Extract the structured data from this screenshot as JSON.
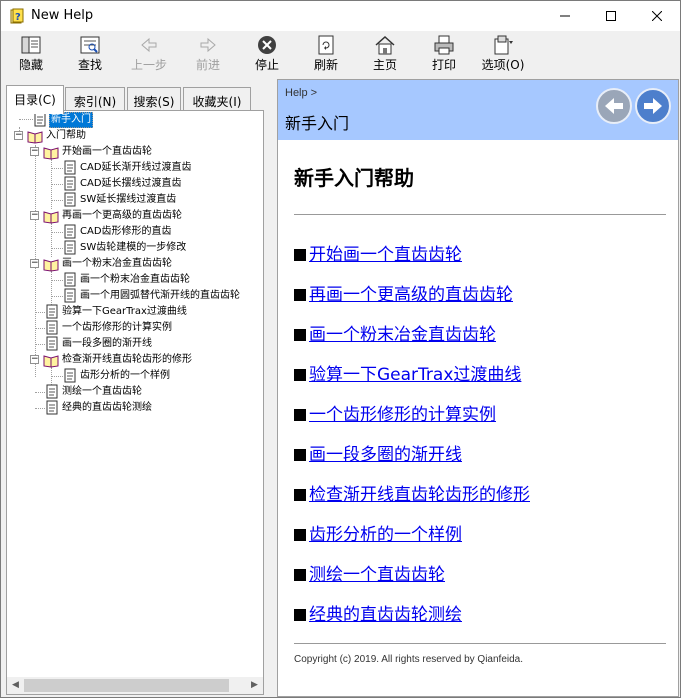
{
  "window": {
    "title": "New Help",
    "icon": "help-book-icon",
    "controls": [
      "minimize-icon",
      "maximize-icon",
      "close-icon"
    ]
  },
  "toolbar": {
    "hide": "隐藏",
    "find": "查找",
    "back": "上一步",
    "forward": "前进",
    "stop": "停止",
    "refresh": "刷新",
    "home": "主页",
    "print": "打印",
    "options": "选项(O)"
  },
  "tabs": {
    "contents": "目录(C)",
    "index": "索引(N)",
    "search": "搜索(S)",
    "favorites": "收藏夹(I)"
  },
  "tree": {
    "n0": "新手入门",
    "n1": "入门帮助",
    "n2": "开始画一个直齿齿轮",
    "n3": "CAD延长渐开线过渡直齿",
    "n4": "CAD延长摆线过渡直齿",
    "n5": "SW延长摆线过渡直齿",
    "n6": "再画一个更高级的直齿齿轮",
    "n7": "CAD齿形修形的直齿",
    "n8": "SW齿轮建模的一步修改",
    "n9": "画一个粉末冶金直齿齿轮",
    "n10": "画一个粉末冶金直齿齿轮",
    "n11": "画一个用圆弧替代渐开线的直齿齿轮",
    "n12": "验算一下GearTrax过渡曲线",
    "n13": "一个齿形修形的计算实例",
    "n14": "画一段多圈的渐开线",
    "n15": "检查渐开线直齿轮齿形的修形",
    "n16": "齿形分析的一个样例",
    "n17": "测绘一个直齿齿轮",
    "n18": "经典的直齿齿轮测绘"
  },
  "content": {
    "breadcrumb": "Help >",
    "header_title": "新手入门",
    "title": "新手入门帮助",
    "topics": [
      "开始画一个直齿齿轮",
      "再画一个更高级的直齿齿轮",
      "画一个粉末冶金直齿齿轮",
      "验算一下GearTrax过渡曲线",
      "一个齿形修形的计算实例",
      "画一段多圈的渐开线",
      "检查渐开线直齿轮齿形的修形",
      "齿形分析的一个样例",
      "测绘一个直齿齿轮",
      "经典的直齿齿轮测绘"
    ],
    "copyright": "Copyright (c) 2019. All rights reserved by Qianfeida."
  },
  "colors": {
    "header_bg": "#a6c8ff",
    "link": "#0000ee",
    "selection": "#0078d7",
    "nav_circle": "#5b8fd6"
  }
}
